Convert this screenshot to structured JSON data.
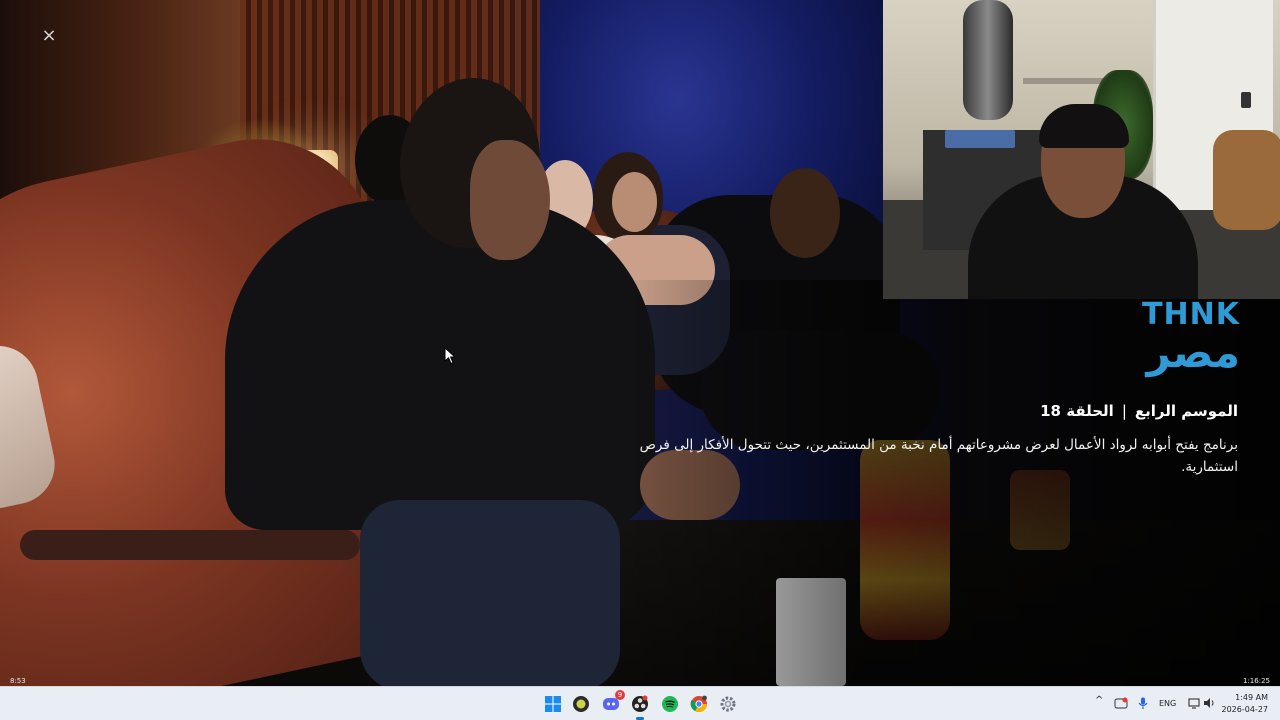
{
  "player": {
    "close_label": "×",
    "time_current": "8:53",
    "time_total": "1:16:25"
  },
  "show": {
    "logo_top": "THNK",
    "logo_bottom": "مصر",
    "season": "الموسم الرابع",
    "separator": "|",
    "episode": "الحلقة 18",
    "description": "برنامج يفتح أبوابه لرواد الأعمال لعرض مشروعاتهم أمام نخبة من المستثمرين، حيث تتحول الأفكار إلى فرص استثمارية."
  },
  "colors": {
    "logo": "#2f9ad6",
    "taskbar": "#e9edf4",
    "active_indicator": "#1a73d9"
  },
  "taskbar": {
    "apps": [
      {
        "name": "windows-start-icon"
      },
      {
        "name": "app-round-green-icon"
      },
      {
        "name": "discord-icon",
        "badge": "9"
      },
      {
        "name": "obs-icon",
        "active": true
      },
      {
        "name": "spotify-icon"
      },
      {
        "name": "chrome-icon"
      },
      {
        "name": "settings-gear-icon"
      }
    ],
    "tray": {
      "chevron": "^",
      "language": "ENG",
      "time": "1:49 AM",
      "date": "2026-04-27"
    }
  }
}
